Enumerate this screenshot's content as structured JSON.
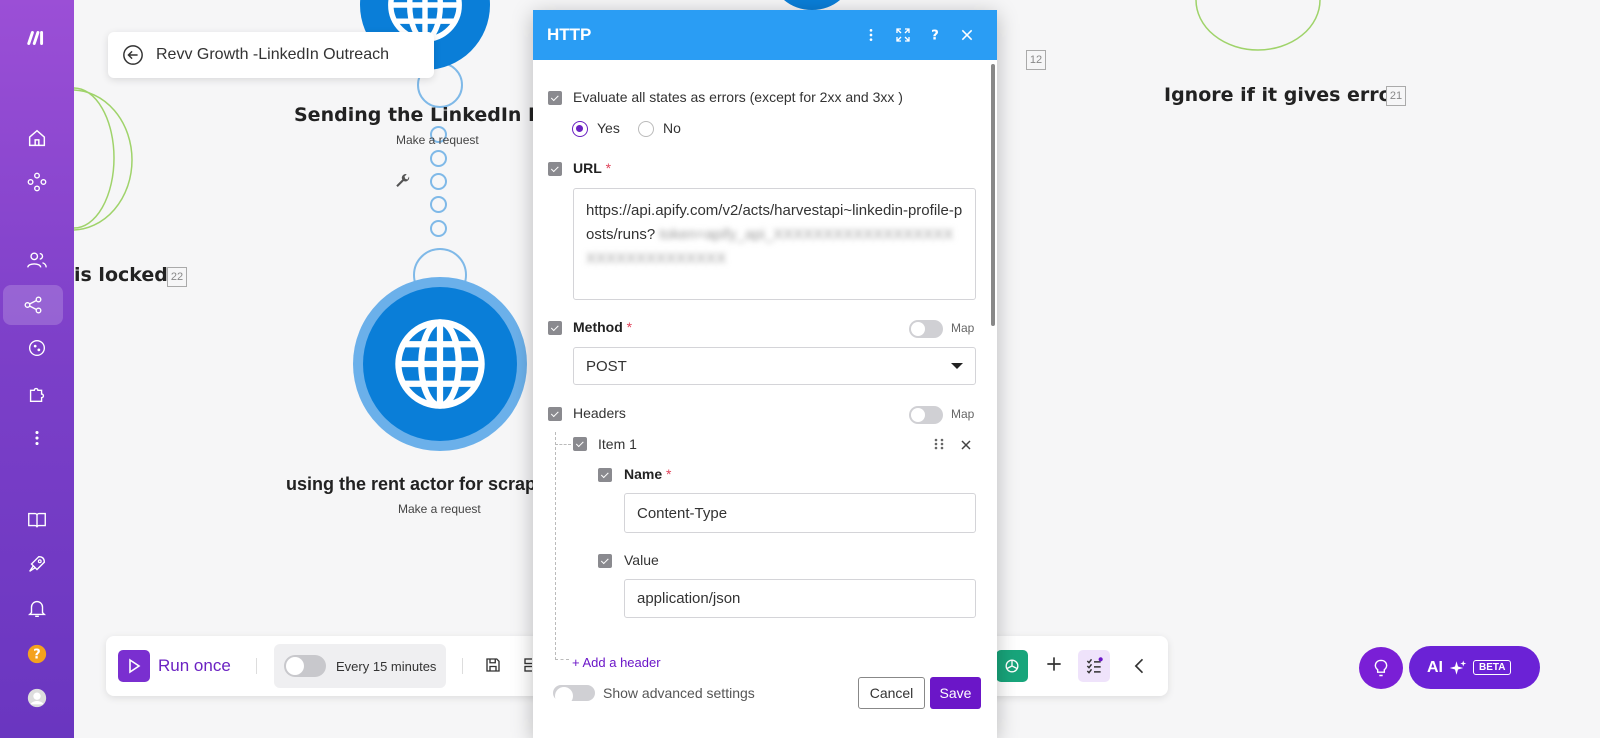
{
  "breadcrumb": {
    "title": "Revv Growth -LinkedIn Outreach"
  },
  "canvas": {
    "node_top": {
      "title": "Sending the LinkedIn Rec",
      "subtitle": "Make a request"
    },
    "node_main": {
      "title": "using the rent actor for scraping t",
      "subtitle": "Make a request"
    },
    "locked_label": "is locked",
    "locked_id": "22",
    "ignore_label": "Ignore if it gives error",
    "ignore_id": "21",
    "id_12": "12"
  },
  "toolbar": {
    "run_label": "Run once",
    "schedule_label": "Every 15 minutes"
  },
  "ai_button": {
    "label": "AI",
    "badge": "BETA"
  },
  "modal": {
    "title": "HTTP",
    "evaluate_label": "Evaluate all states as errors (except for 2xx and 3xx )",
    "yes_label": "Yes",
    "no_label": "No",
    "evaluate_value": "Yes",
    "url_label": "URL",
    "url_value": "https://api.apify.com/v2/acts/harvestapi~linkedin-profile-posts/runs?",
    "url_blurred": "token=apify_api_XXXXXXXXXXXXXXXXXXXXXXXXXXXXXXXX",
    "method_label": "Method",
    "method_value": "POST",
    "map_label": "Map",
    "headers_label": "Headers",
    "item_label": "Item 1",
    "name_label": "Name",
    "name_value": "Content-Type",
    "value_label": "Value",
    "value_value": "application/json",
    "add_header_label": "+ Add a header",
    "advanced_label": "Show advanced settings",
    "cancel_label": "Cancel",
    "save_label": "Save"
  },
  "colors": {
    "sidebar": "#8a45d0",
    "modal_header": "#2a9df4",
    "accent": "#6b16c8",
    "node": "#0a7ed8"
  }
}
